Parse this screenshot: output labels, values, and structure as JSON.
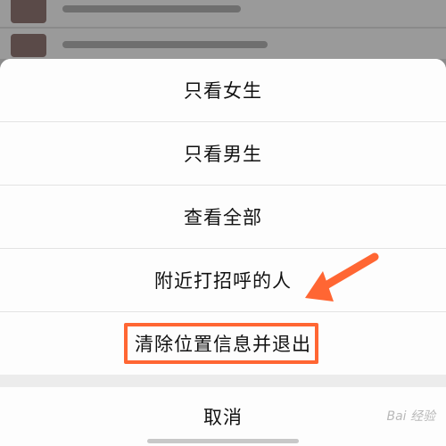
{
  "menu": {
    "items": [
      {
        "label": "只看女生"
      },
      {
        "label": "只看男生"
      },
      {
        "label": "查看全部"
      },
      {
        "label": "附近打招呼的人"
      },
      {
        "label": "清除位置信息并退出"
      }
    ],
    "cancel_label": "取消"
  },
  "annotation": {
    "color": "#ff6633"
  },
  "watermark": {
    "text": "Bai 经验"
  }
}
